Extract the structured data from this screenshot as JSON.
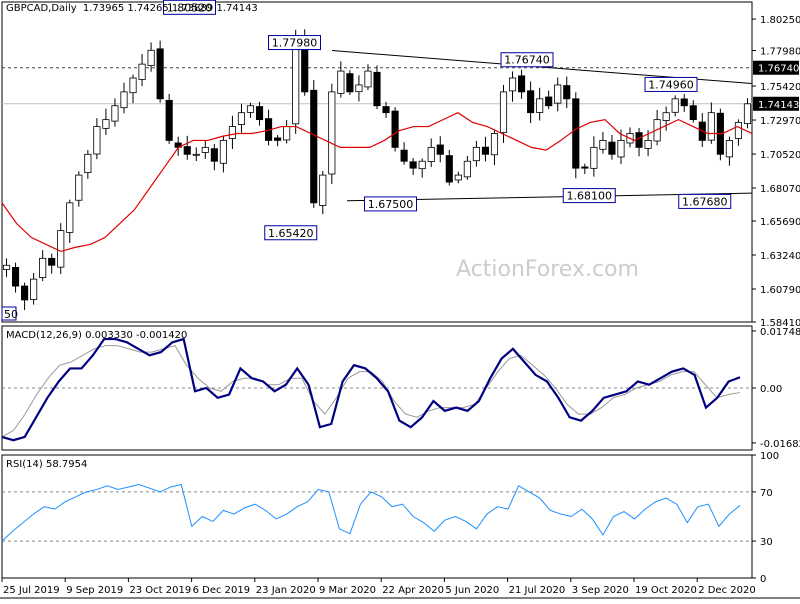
{
  "header": {
    "instrument": "GBPCAD,Daily",
    "ohlc": "1.73965 1.74265 1.73889 1.74143"
  },
  "watermark": "ActionForex.com",
  "colors": {
    "candles": "#000000",
    "moving_average": "#e00000",
    "macd_line": "#000080",
    "signal_line": "#999999",
    "rsi_line": "#1e90ff",
    "price_tag_bg": "#000000",
    "label_bg": "#ffffff",
    "label_border": "#0000a0"
  },
  "chart_data": [
    {
      "type": "candlestick",
      "title": "GBPCAD,Daily",
      "x_tick_labels": [
        "25 Jul 2019",
        "9 Sep 2019",
        "23 Oct 2019",
        "6 Dec 2019",
        "23 Jan 2020",
        "9 Mar 2020",
        "22 Apr 2020",
        "5 Jun 2020",
        "21 Jul 2020",
        "3 Sep 2020",
        "19 Oct 2020",
        "2 Dec 2020"
      ],
      "y_tick_labels": [
        "1.80250",
        "1.77980",
        "1.75420",
        "1.72970",
        "1.70520",
        "1.68070",
        "1.65690",
        "1.63240",
        "1.60790",
        "1.58410"
      ],
      "ylim": [
        1.5841,
        1.8148
      ],
      "current_price": "1.74143",
      "horizontal_level": "1.76740",
      "moving_average_present": true,
      "peak_labels": [
        "1.80520",
        "1.77980",
        "1.76740",
        "1.74960"
      ],
      "trough_labels": [
        "1.65420",
        "1.67500",
        "1.68100",
        "1.67680"
      ],
      "partial_left_label": "50",
      "close_series": [
        1.625,
        1.61,
        1.6,
        1.615,
        1.63,
        1.625,
        1.65,
        1.67,
        1.69,
        1.705,
        1.725,
        1.73,
        1.74,
        1.75,
        1.76,
        1.77,
        1.78,
        1.745,
        1.715,
        1.71,
        1.705,
        1.705,
        1.71,
        1.7,
        1.715,
        1.725,
        1.735,
        1.74,
        1.73,
        1.715,
        1.715,
        1.725,
        1.79,
        1.75,
        1.67,
        1.69,
        1.75,
        1.765,
        1.75,
        1.755,
        1.765,
        1.74,
        1.735,
        1.71,
        1.7,
        1.695,
        1.7,
        1.71,
        1.705,
        1.685,
        1.69,
        1.7,
        1.71,
        1.705,
        1.72,
        1.75,
        1.76,
        1.75,
        1.735,
        1.745,
        1.74,
        1.755,
        1.745,
        1.695,
        1.695,
        1.71,
        1.715,
        1.705,
        1.715,
        1.72,
        1.71,
        1.715,
        1.73,
        1.735,
        1.745,
        1.74,
        1.73,
        1.715,
        1.735,
        1.705,
        1.715,
        1.728,
        1.7414
      ],
      "ma_series": [
        1.67,
        1.655,
        1.645,
        1.64,
        1.635,
        1.638,
        1.64,
        1.645,
        1.655,
        1.665,
        1.68,
        1.695,
        1.71,
        1.715,
        1.715,
        1.718,
        1.72,
        1.72,
        1.722,
        1.725,
        1.725,
        1.72,
        1.715,
        1.71,
        1.71,
        1.71,
        1.715,
        1.722,
        1.725,
        1.725,
        1.73,
        1.735,
        1.728,
        1.725,
        1.72,
        1.715,
        1.71,
        1.708,
        1.715,
        1.723,
        1.728,
        1.73,
        1.72,
        1.715,
        1.72,
        1.725,
        1.73,
        1.725,
        1.72,
        1.72,
        1.725,
        1.72
      ],
      "annotations": [
        {
          "label": "1.80520",
          "x": 0.25,
          "y": 1.8052
        },
        {
          "label": "1.77980",
          "x": 0.39,
          "y": 1.7798
        },
        {
          "label": "1.76740",
          "x": 0.7,
          "y": 1.7674
        },
        {
          "label": "1.74960",
          "x": 0.892,
          "y": 1.7496
        },
        {
          "label": "1.65420",
          "x": 0.385,
          "y": 1.6542
        },
        {
          "label": "1.67500",
          "x": 0.518,
          "y": 1.675
        },
        {
          "label": "1.68100",
          "x": 0.783,
          "y": 1.681
        },
        {
          "label": "1.67680",
          "x": 0.937,
          "y": 1.6768
        }
      ],
      "trendlines": [
        {
          "name": "upper",
          "from": {
            "x": 0.44,
            "y": 1.7798
          },
          "to": {
            "x": 1.0,
            "y": 1.756
          }
        },
        {
          "name": "lower",
          "from": {
            "x": 0.46,
            "y": 1.6715
          },
          "to": {
            "x": 1.0,
            "y": 1.677
          }
        }
      ]
    },
    {
      "type": "line",
      "title": "MACD(12,26,9) 0.003330 -0.001420",
      "y_tick_labels": [
        "0.017482",
        "0.00",
        "-0.01682"
      ],
      "ylim": [
        -0.019,
        0.019
      ],
      "zero_line": true,
      "macd_series": [
        -0.015,
        -0.016,
        -0.015,
        -0.009,
        -0.003,
        0.002,
        0.006,
        0.006,
        0.01,
        0.015,
        0.015,
        0.014,
        0.012,
        0.01,
        0.011,
        0.014,
        0.015,
        -0.001,
        0.0,
        -0.003,
        -0.002,
        0.006,
        0.003,
        0.002,
        -0.001,
        0.001,
        0.006,
        0.001,
        -0.012,
        -0.011,
        0.002,
        0.007,
        0.006,
        0.003,
        -0.001,
        -0.01,
        -0.012,
        -0.009,
        -0.004,
        -0.007,
        -0.006,
        -0.007,
        -0.004,
        0.003,
        0.009,
        0.012,
        0.008,
        0.004,
        0.002,
        -0.003,
        -0.009,
        -0.01,
        -0.007,
        -0.003,
        -0.002,
        -0.001,
        0.002,
        0.001,
        0.003,
        0.005,
        0.006,
        0.004,
        -0.006,
        -0.003,
        0.002,
        0.0033
      ],
      "signal_series": [
        -0.015,
        -0.013,
        -0.008,
        -0.002,
        0.003,
        0.007,
        0.008,
        0.01,
        0.012,
        0.013,
        0.013,
        0.012,
        0.011,
        0.011,
        0.012,
        0.013,
        0.007,
        0.003,
        0.0,
        -0.001,
        0.002,
        0.003,
        0.003,
        0.001,
        0.001,
        0.003,
        0.003,
        -0.004,
        -0.008,
        -0.003,
        0.003,
        0.005,
        0.005,
        0.002,
        -0.004,
        -0.008,
        -0.009,
        -0.007,
        -0.006,
        -0.006,
        -0.006,
        -0.005,
        0.0,
        0.005,
        0.009,
        0.01,
        0.007,
        0.004,
        0.0,
        -0.005,
        -0.008,
        -0.008,
        -0.006,
        -0.003,
        -0.002,
        0.0,
        0.001,
        0.002,
        0.004,
        0.005,
        0.005,
        0.001,
        -0.003,
        -0.002,
        -0.0014
      ]
    },
    {
      "type": "line",
      "title": "RSI(14) 58.7954",
      "y_tick_labels": [
        "100",
        "70",
        "30",
        "0"
      ],
      "ylim": [
        0,
        100
      ],
      "reference_levels": [
        70,
        30
      ],
      "rsi_series": [
        30,
        38,
        45,
        52,
        58,
        56,
        62,
        66,
        70,
        72,
        75,
        72,
        74,
        76,
        73,
        70,
        74,
        76,
        42,
        50,
        46,
        55,
        52,
        57,
        60,
        55,
        48,
        52,
        58,
        62,
        72,
        70,
        40,
        36,
        60,
        70,
        66,
        58,
        60,
        50,
        45,
        38,
        47,
        50,
        46,
        40,
        52,
        58,
        56,
        75,
        70,
        65,
        55,
        52,
        50,
        56,
        48,
        35,
        50,
        54,
        48,
        56,
        62,
        65,
        60,
        45,
        58,
        60,
        42,
        52,
        59
      ]
    }
  ]
}
